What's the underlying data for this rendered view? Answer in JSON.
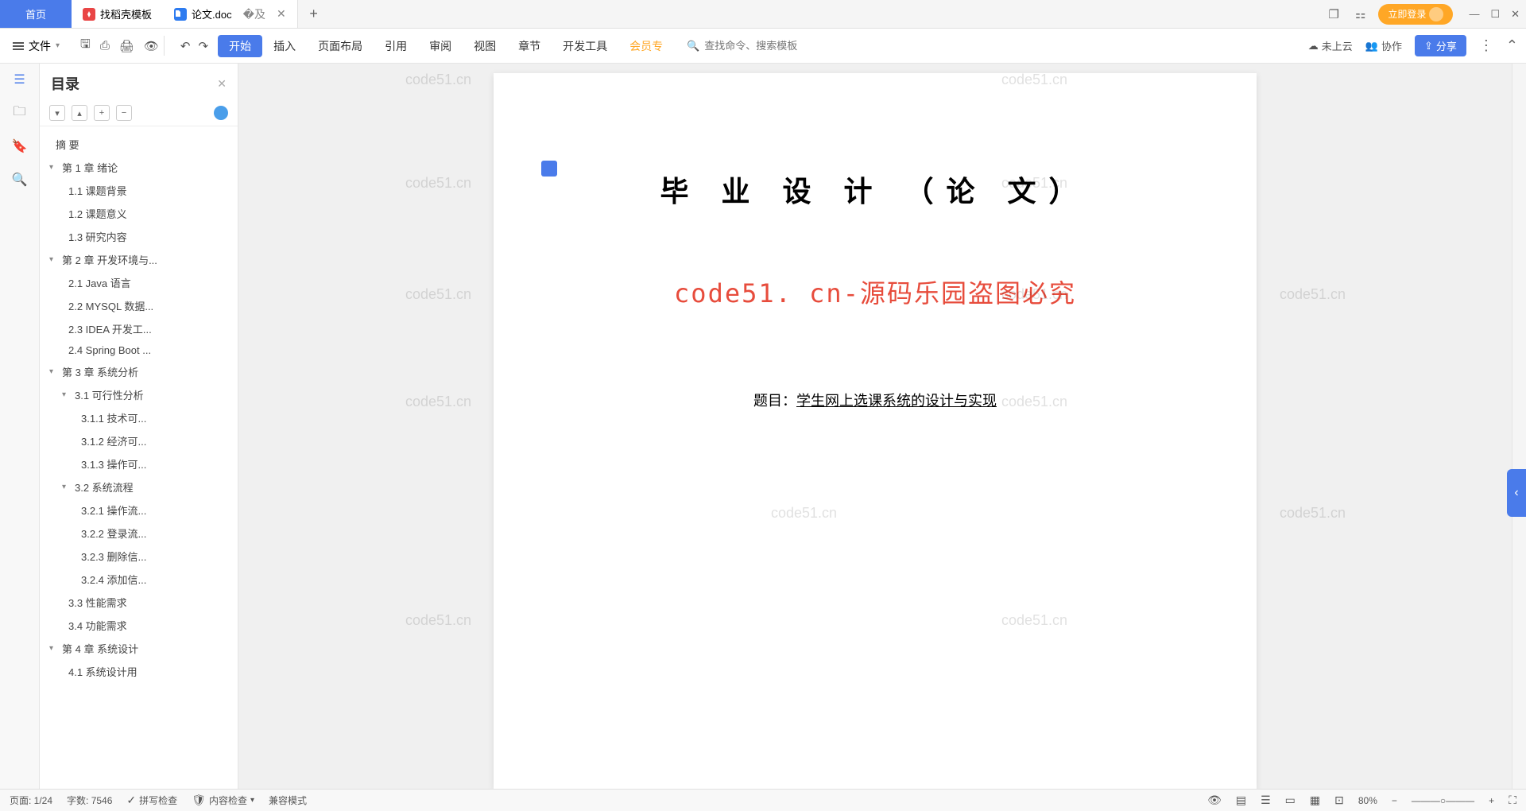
{
  "titlebar": {
    "tab_home": "首页",
    "tab_2": "找稻壳模板",
    "tab_3": "论文.doc",
    "login": "立即登录"
  },
  "menubar": {
    "file": "文件",
    "items": [
      "开始",
      "插入",
      "页面布局",
      "引用",
      "审阅",
      "视图",
      "章节",
      "开发工具",
      "会员专"
    ],
    "search_placeholder": "查找命令、搜索模板",
    "cloud": "未上云",
    "collab": "协作",
    "share": "分享"
  },
  "outline": {
    "title": "目录",
    "items": [
      {
        "lvl": 0,
        "text": "摘 要"
      },
      {
        "lvl": 1,
        "text": "第 1 章 绪论",
        "c": true
      },
      {
        "lvl": 2,
        "text": "1.1 课题背景"
      },
      {
        "lvl": 2,
        "text": "1.2 课题意义"
      },
      {
        "lvl": 2,
        "text": "1.3 研究内容"
      },
      {
        "lvl": 1,
        "text": "第 2 章 开发环境与...",
        "c": true
      },
      {
        "lvl": 2,
        "text": "2.1 Java 语言"
      },
      {
        "lvl": 2,
        "text": "2.2 MYSQL 数据..."
      },
      {
        "lvl": 2,
        "text": "2.3 IDEA 开发工..."
      },
      {
        "lvl": 2,
        "text": "2.4 Spring Boot ..."
      },
      {
        "lvl": 1,
        "text": "第 3 章 系统分析",
        "c": true
      },
      {
        "lvl": 3,
        "text": "3.1 可行性分析",
        "c": true
      },
      {
        "lvl": 4,
        "text": "3.1.1 技术可..."
      },
      {
        "lvl": 4,
        "text": "3.1.2 经济可..."
      },
      {
        "lvl": 4,
        "text": "3.1.3 操作可..."
      },
      {
        "lvl": 3,
        "text": "3.2 系统流程",
        "c": true
      },
      {
        "lvl": 4,
        "text": "3.2.1 操作流..."
      },
      {
        "lvl": 4,
        "text": "3.2.2 登录流..."
      },
      {
        "lvl": 4,
        "text": "3.2.3 删除信..."
      },
      {
        "lvl": 4,
        "text": "3.2.4 添加信..."
      },
      {
        "lvl": 2,
        "text": "3.3 性能需求"
      },
      {
        "lvl": 2,
        "text": "3.4 功能需求"
      },
      {
        "lvl": 1,
        "text": "第 4 章 系统设计",
        "c": true
      },
      {
        "lvl": 2,
        "text": "4.1 系统设计用"
      }
    ]
  },
  "document": {
    "title": "毕 业 设 计 （论 文）",
    "watermark_text": "code51. cn-源码乐园盗图必究",
    "subject_label": "题目：",
    "subject_value": "学生网上选课系统的设计与实现",
    "wm": "code51.cn"
  },
  "statusbar": {
    "page": "页面: 1/24",
    "words": "字数: 7546",
    "spell": "拼写检查",
    "content": "内容检查",
    "compat": "兼容模式",
    "zoom": "80%"
  }
}
